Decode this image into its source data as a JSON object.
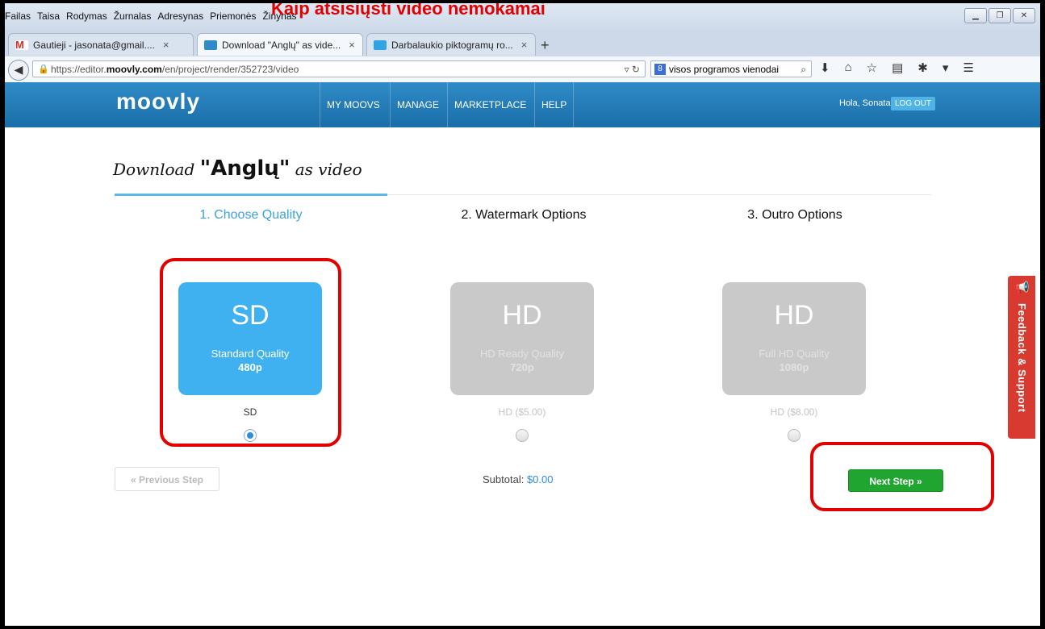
{
  "banner": "Kaip atsisiųsti video nemokamai",
  "menu": [
    "Failas",
    "Taisa",
    "Rodymas",
    "Žurnalas",
    "Adresynas",
    "Priemonės",
    "Žinynas"
  ],
  "tabs": [
    {
      "label": "Gautieji - jasonata@gmail....",
      "close": "×"
    },
    {
      "label": "Download \"Anglų\" as vide...",
      "close": "×"
    },
    {
      "label": "Darbalaukio piktogramų ro...",
      "close": "×"
    }
  ],
  "new_tab": "+",
  "url": {
    "prefix": "https://editor.",
    "domain": "moovly.com",
    "path": "/en/project/render/352723/video"
  },
  "search": {
    "value": "visos programos vienodai",
    "engine": "8"
  },
  "header": {
    "logo": "moovly",
    "nav": [
      "MY MOOVS",
      "MANAGE",
      "MARKETPLACE",
      "HELP"
    ],
    "greeting": "Hola, Sonata",
    "logout": "LOG OUT"
  },
  "page": {
    "title_prefix": "Download ",
    "title_name": "\"Anglų\"",
    "title_suffix": " as video",
    "steps": [
      "1. Choose Quality",
      "2. Watermark Options",
      "3. Outro Options"
    ],
    "qualities": [
      {
        "code": "SD",
        "desc": "Standard Quality",
        "res": "480p",
        "label": "SD",
        "selected": true
      },
      {
        "code": "HD",
        "desc": "HD Ready Quality",
        "res": "720p",
        "label": "HD ($5.00)",
        "selected": false
      },
      {
        "code": "HD",
        "desc": "Full HD Quality",
        "res": "1080p",
        "label": "HD ($8.00)",
        "selected": false
      }
    ],
    "prev_button": "« Previous Step",
    "subtotal_label": "Subtotal:",
    "subtotal_amount": "$0.00",
    "next_button": "Next Step »"
  },
  "feedback": "Feedback & Support",
  "colors": {
    "accent": "#3fb0f0",
    "header": "#1a6ea8",
    "next": "#1fa530",
    "highlight": "#e30000",
    "feedback": "#d93a2f"
  }
}
